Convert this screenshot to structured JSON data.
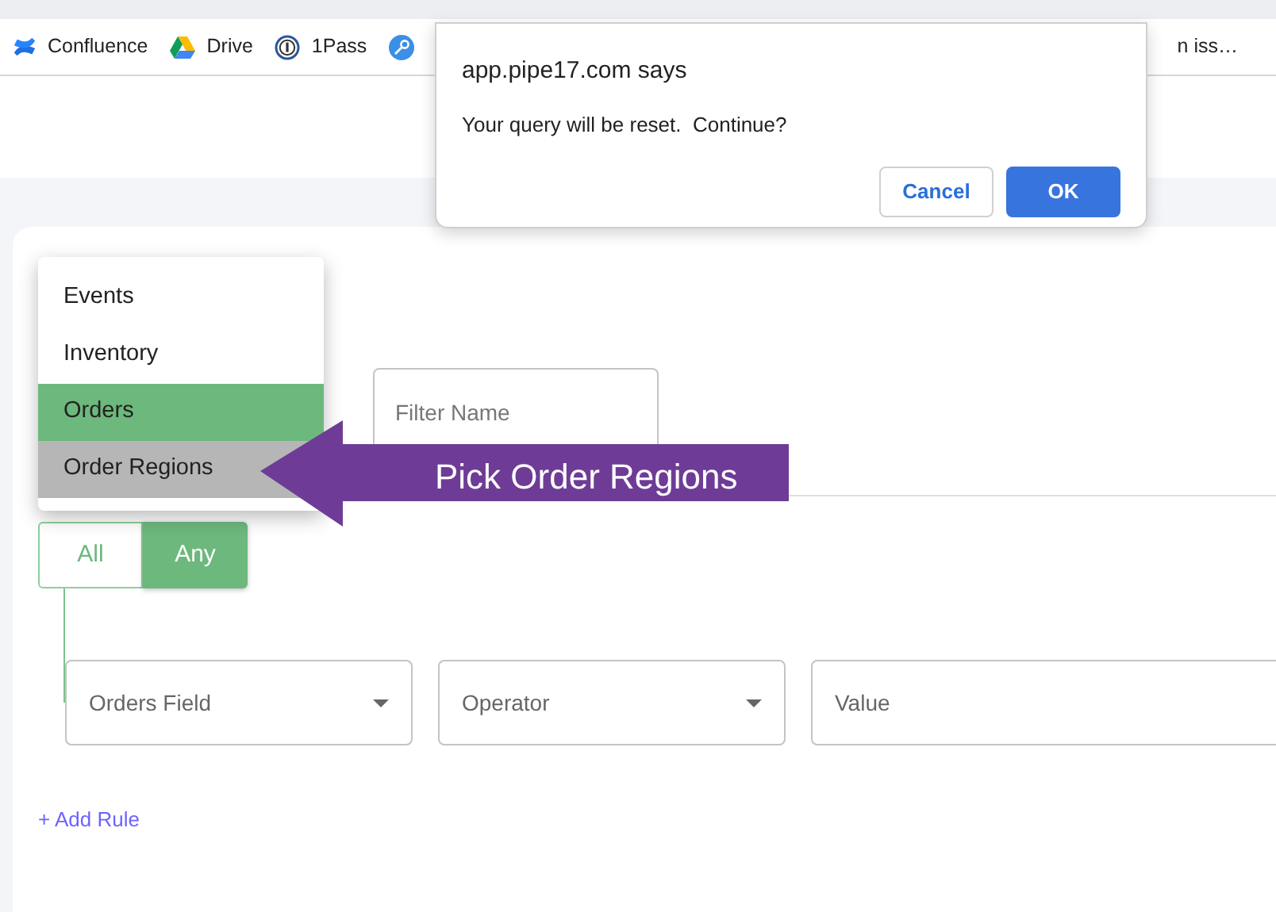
{
  "bookmarks": [
    {
      "kind": "confluence",
      "label": "Confluence"
    },
    {
      "kind": "drive",
      "label": "Drive"
    },
    {
      "kind": "onepass",
      "label": "1Pass"
    },
    {
      "kind": "key"
    },
    {
      "kind": "text",
      "label": "n iss…"
    }
  ],
  "dialog": {
    "title": "app.pipe17.com says",
    "message": "Your query will be reset.  Continue?",
    "buttons": [
      {
        "label": "Cancel",
        "primary": false
      },
      {
        "label": "OK",
        "primary": true
      }
    ]
  },
  "menu": {
    "items": [
      {
        "label": "Events",
        "selected": false,
        "hovered": false
      },
      {
        "label": "Inventory",
        "selected": false,
        "hovered": false
      },
      {
        "label": "Orders",
        "selected": true,
        "hovered": false
      },
      {
        "label": "Order Regions",
        "selected": false,
        "hovered": true
      }
    ]
  },
  "filter_name": {
    "placeholder": "Filter Name"
  },
  "callout": {
    "text": "Pick Order Regions"
  },
  "match_toggle": [
    {
      "label": "All",
      "selected": false
    },
    {
      "label": "Any",
      "selected": true
    }
  ],
  "rule": {
    "fields": [
      {
        "kind": "select",
        "placeholder": "Orders Field"
      },
      {
        "kind": "select",
        "placeholder": "Operator"
      },
      {
        "kind": "input",
        "placeholder": "Value"
      }
    ]
  },
  "add_rule": {
    "label": "+ Add Rule"
  }
}
